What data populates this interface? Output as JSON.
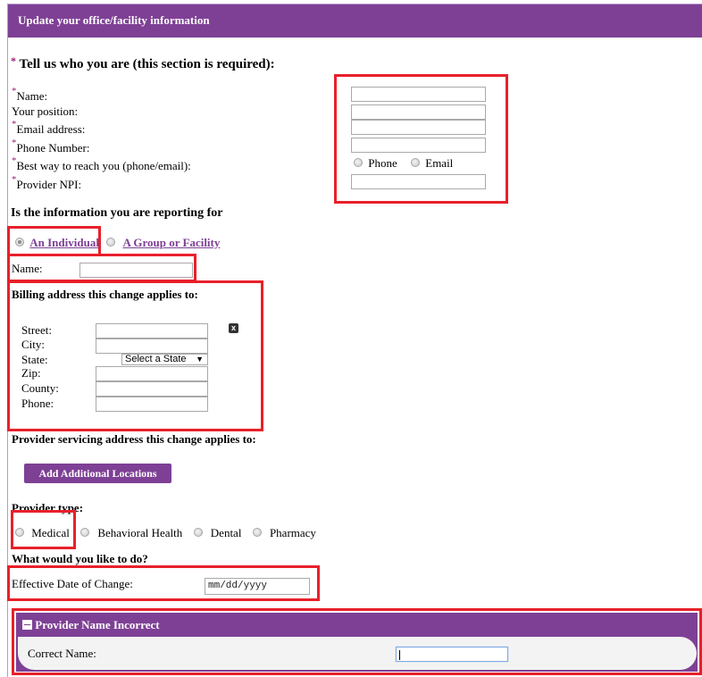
{
  "header": {
    "title": "Update your office/facility information"
  },
  "who_section": {
    "heading": "Tell us who you are (this section is required):",
    "required_marker": "*",
    "fields": [
      {
        "label": "Name:",
        "required": true,
        "value": ""
      },
      {
        "label": "Your position:",
        "required": false,
        "value": ""
      },
      {
        "label": "Email address:",
        "required": true,
        "value": ""
      },
      {
        "label": "Phone Number:",
        "required": true,
        "value": ""
      },
      {
        "label": "Best way to reach you (phone/email):",
        "required": true
      },
      {
        "label": "Provider NPI:",
        "required": true,
        "value": ""
      }
    ],
    "contact_options": [
      {
        "label": "Phone",
        "checked": false
      },
      {
        "label": "Email",
        "checked": false
      }
    ]
  },
  "reporting": {
    "heading": "Is the information you are reporting for",
    "options": [
      {
        "label": "An Individual",
        "checked": true
      },
      {
        "label": "A Group or Facility",
        "checked": false
      }
    ],
    "name_label": "Name:",
    "name_value": ""
  },
  "billing": {
    "heading": "Billing address this change applies to:",
    "fields": {
      "street": "Street:",
      "city": "City:",
      "state": "State:",
      "zip": "Zip:",
      "county": "County:",
      "phone": "Phone:"
    },
    "state_select": "Select a State",
    "remove_icon": "x-close-icon"
  },
  "servicing": {
    "heading": "Provider servicing address this change applies to:",
    "add_button": "Add Additional Locations"
  },
  "provider_type": {
    "heading": "Provider type:",
    "options": [
      {
        "label": "Medical",
        "checked": false
      },
      {
        "label": "Behavioral Health",
        "checked": false
      },
      {
        "label": "Dental",
        "checked": false
      },
      {
        "label": "Pharmacy",
        "checked": false
      }
    ]
  },
  "action": {
    "heading": "What would you like to do?",
    "effective_date_label": "Effective Date of Change:",
    "effective_date_placeholder": "mm/dd/yyyy"
  },
  "name_panel": {
    "title": "Provider Name Incorrect",
    "collapse_icon": "minus-icon",
    "correct_name_label": "Correct Name:",
    "correct_name_value": ""
  },
  "colors": {
    "brand_purple": "#7e4095",
    "required_star": "#a0207a",
    "highlight_red": "#e8202a"
  }
}
